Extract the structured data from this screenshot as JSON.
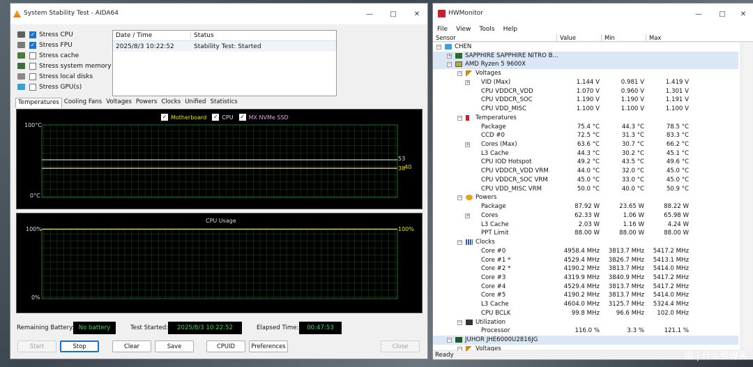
{
  "aida": {
    "title": "System Stability Test - AIDA64",
    "stress_options": [
      {
        "label": "Stress CPU",
        "checked": true
      },
      {
        "label": "Stress FPU",
        "checked": true
      },
      {
        "label": "Stress cache",
        "checked": false
      },
      {
        "label": "Stress system memory",
        "checked": false
      },
      {
        "label": "Stress local disks",
        "checked": false
      },
      {
        "label": "Stress GPU(s)",
        "checked": false
      }
    ],
    "log": {
      "headers": [
        "Date / Time",
        "Status"
      ],
      "rows": [
        {
          "time": "2025/8/3 10:22:52",
          "status": "Stability Test: Started"
        }
      ]
    },
    "tabs": [
      "Temperatures",
      "Cooling Fans",
      "Voltages",
      "Powers",
      "Clocks",
      "Unified",
      "Statistics"
    ],
    "temp_graph": {
      "legend": [
        "Motherboard",
        "CPU",
        "MX NVMe SSD"
      ],
      "y_top": "100°C",
      "y_bottom": "0°C",
      "readout_1": "53",
      "readout_2": "38",
      "readout_3": "40"
    },
    "cpu_graph": {
      "title": "CPU Usage",
      "y_top": "100%",
      "y_bottom": "0%",
      "readout": "100%"
    },
    "bottom": {
      "battery_label": "Remaining Battery:",
      "battery_value": "No battery",
      "started_label": "Test Started:",
      "started_value": "2025/8/3 10:22:52",
      "elapsed_label": "Elapsed Time:",
      "elapsed_value": "00:47:53"
    },
    "buttons": {
      "start": "Start",
      "stop": "Stop",
      "clear": "Clear",
      "save": "Save",
      "cpuid": "CPUID",
      "preferences": "Preferences",
      "close": "Close"
    }
  },
  "hw": {
    "title": "HWMonitor",
    "menu": [
      "File",
      "View",
      "Tools",
      "Help"
    ],
    "columns": [
      "Sensor",
      "Value",
      "Min",
      "Max"
    ],
    "status": "Ready",
    "rows": [
      {
        "lvl": 0,
        "name": "CHEN",
        "type": "computer",
        "exp": "-"
      },
      {
        "lvl": 1,
        "name": "SAPPHIRE SAPPHIRE NITRO B...",
        "type": "board",
        "exp": "+",
        "hl": true
      },
      {
        "lvl": 1,
        "name": "AMD Ryzen 5 9600X",
        "type": "chip",
        "exp": "-",
        "hl": true
      },
      {
        "lvl": 2,
        "name": "Voltages",
        "type": "volt",
        "exp": "-"
      },
      {
        "lvl": 3,
        "name": "VID (Max)",
        "exp": "+",
        "v": "1.144 V",
        "mn": "0.981 V",
        "mx": "1.419 V"
      },
      {
        "lvl": 3,
        "name": "CPU VDDCR_VDD",
        "v": "1.070 V",
        "mn": "0.960 V",
        "mx": "1.301 V"
      },
      {
        "lvl": 3,
        "name": "CPU VDDCR_SOC",
        "v": "1.190 V",
        "mn": "1.190 V",
        "mx": "1.191 V"
      },
      {
        "lvl": 3,
        "name": "CPU VDD_MISC",
        "v": "1.100 V",
        "mn": "1.100 V",
        "mx": "1.100 V"
      },
      {
        "lvl": 2,
        "name": "Temperatures",
        "type": "temp",
        "exp": "-"
      },
      {
        "lvl": 3,
        "name": "Package",
        "v": "75.4 °C",
        "mn": "44.3 °C",
        "mx": "78.5 °C"
      },
      {
        "lvl": 3,
        "name": "CCD #0",
        "v": "72.5 °C",
        "mn": "31.3 °C",
        "mx": "83.3 °C"
      },
      {
        "lvl": 3,
        "name": "Cores (Max)",
        "exp": "+",
        "v": "63.6 °C",
        "mn": "30.7 °C",
        "mx": "66.2 °C"
      },
      {
        "lvl": 3,
        "name": "L3 Cache",
        "v": "44.3 °C",
        "mn": "30.2 °C",
        "mx": "45.1 °C"
      },
      {
        "lvl": 3,
        "name": "CPU IOD Hotspot",
        "v": "49.2 °C",
        "mn": "43.5 °C",
        "mx": "49.6 °C"
      },
      {
        "lvl": 3,
        "name": "CPU VDDCR_VDD VRM",
        "v": "44.0 °C",
        "mn": "32.0 °C",
        "mx": "45.0 °C"
      },
      {
        "lvl": 3,
        "name": "CPU VDDCR_SOC VRM",
        "v": "45.0 °C",
        "mn": "33.0 °C",
        "mx": "45.0 °C"
      },
      {
        "lvl": 3,
        "name": "CPU VDD_MISC VRM",
        "v": "50.0 °C",
        "mn": "40.0 °C",
        "mx": "50.9 °C"
      },
      {
        "lvl": 2,
        "name": "Powers",
        "type": "power",
        "exp": "-"
      },
      {
        "lvl": 3,
        "name": "Package",
        "v": "87.92 W",
        "mn": "23.65 W",
        "mx": "88.22 W"
      },
      {
        "lvl": 3,
        "name": "Cores",
        "exp": "+",
        "v": "62.33 W",
        "mn": "1.06 W",
        "mx": "65.98 W"
      },
      {
        "lvl": 3,
        "name": "L3 Cache",
        "v": "2.03 W",
        "mn": "1.16 W",
        "mx": "4.24 W"
      },
      {
        "lvl": 3,
        "name": "PPT Limit",
        "v": "88.00 W",
        "mn": "88.00 W",
        "mx": "88.00 W"
      },
      {
        "lvl": 2,
        "name": "Clocks",
        "type": "clock",
        "exp": "-"
      },
      {
        "lvl": 3,
        "name": "Core #0",
        "v": "4958.4 MHz",
        "mn": "3813.7 MHz",
        "mx": "5417.2 MHz"
      },
      {
        "lvl": 3,
        "name": "Core #1 *",
        "v": "4529.4 MHz",
        "mn": "3826.7 MHz",
        "mx": "5413.1 MHz"
      },
      {
        "lvl": 3,
        "name": "Core #2 *",
        "v": "4190.2 MHz",
        "mn": "3813.7 MHz",
        "mx": "5414.0 MHz"
      },
      {
        "lvl": 3,
        "name": "Core #3",
        "v": "4319.9 MHz",
        "mn": "3840.9 MHz",
        "mx": "5417.2 MHz"
      },
      {
        "lvl": 3,
        "name": "Core #4",
        "v": "4529.4 MHz",
        "mn": "3813.7 MHz",
        "mx": "5417.2 MHz"
      },
      {
        "lvl": 3,
        "name": "Core #5",
        "v": "4190.2 MHz",
        "mn": "3813.7 MHz",
        "mx": "5414.0 MHz"
      },
      {
        "lvl": 3,
        "name": "L3 Cache",
        "v": "4604.0 MHz",
        "mn": "3125.7 MHz",
        "mx": "5324.4 MHz"
      },
      {
        "lvl": 3,
        "name": "CPU BCLK",
        "v": "99.8 MHz",
        "mn": "96.6 MHz",
        "mx": "102.0 MHz"
      },
      {
        "lvl": 2,
        "name": "Utilization",
        "type": "util",
        "exp": "-"
      },
      {
        "lvl": 3,
        "name": "Processor",
        "v": "116.0 %",
        "mn": "3.3 %",
        "mx": "121.1 %"
      },
      {
        "lvl": 1,
        "name": "JUHOR JHE6000U2816JG",
        "type": "mem",
        "exp": "-",
        "hl": true
      },
      {
        "lvl": 2,
        "name": "Voltages",
        "type": "volt",
        "exp": "-"
      }
    ]
  },
  "watermark": "值 | 什么值得买"
}
